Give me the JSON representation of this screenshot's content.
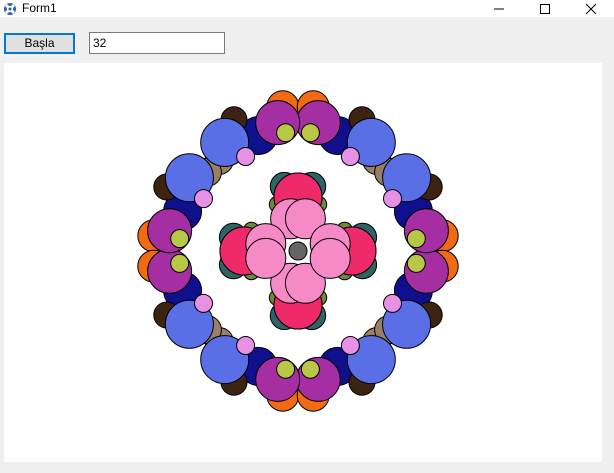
{
  "window": {
    "title": "Form1"
  },
  "toolbar": {
    "start_label": "Başla",
    "count_value": "32"
  },
  "icons": {
    "app": "app-icon",
    "minimize": "minimize-icon",
    "maximize": "maximize-icon",
    "close": "close-icon"
  },
  "palette": {
    "pink_red": "#ee2a6b",
    "light_pink": "#f68ac6",
    "royal_blue": "#5a6ee6",
    "purple": "#a52ea2",
    "navy": "#10108f",
    "orange": "#f26b12",
    "brown": "#3d2412",
    "tan": "#9a7f67",
    "olive": "#b8c846",
    "lavender": "#e690e6",
    "teal": "#2e6466",
    "cyan": "#139ec4",
    "olive_dark": "#6c8a3a",
    "green": "#3dbb4b",
    "gray": "#656565"
  }
}
